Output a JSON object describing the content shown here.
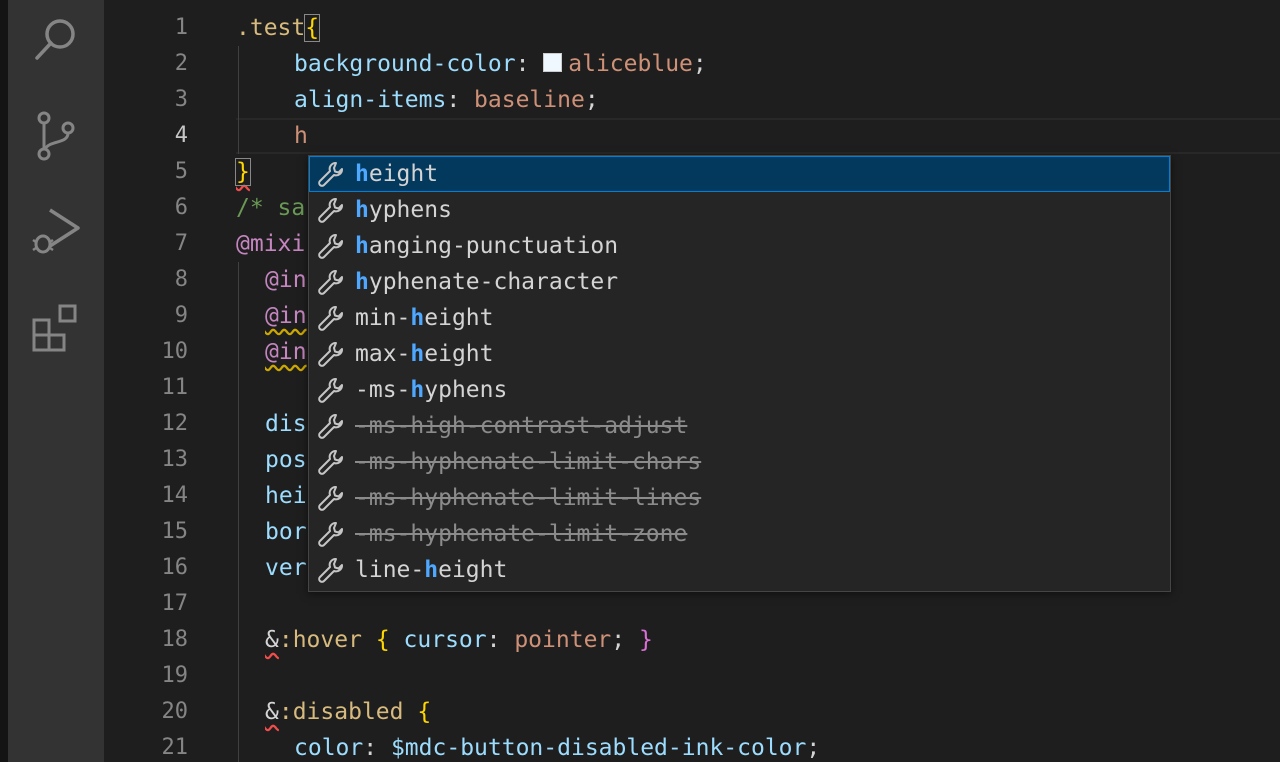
{
  "activity_bar": {
    "items": [
      {
        "icon": "search-icon"
      },
      {
        "icon": "source-control-icon"
      },
      {
        "icon": "run-debug-icon"
      },
      {
        "icon": "extensions-icon"
      }
    ]
  },
  "editor": {
    "line_numbers": [
      "1",
      "2",
      "3",
      "4",
      "5",
      "6",
      "7",
      "8",
      "9",
      "10",
      "11",
      "12",
      "13",
      "14",
      "15",
      "16",
      "17",
      "18",
      "19",
      "20",
      "21"
    ],
    "active_line": "4",
    "lines": {
      "l1_selector": ".test",
      "l1_brace": "{",
      "l2_prop": "background-color",
      "l2_value": "aliceblue",
      "l3_prop": "align-items",
      "l3_value": "baseline",
      "l4_text": "h",
      "l5_brace": "}",
      "l6_comment": "/* sa",
      "l7_mixin": "@mixi",
      "l8_include": "@in",
      "l9_include": "@in",
      "l10_include": "@in",
      "l12_prop": "dis",
      "l13_prop": "pos",
      "l14_prop": "hei",
      "l15_prop": "bor",
      "l16_prop": "ver",
      "l18_amp": "&",
      "l18_pseudo": ":hover",
      "l18_open": "{",
      "l18_prop": "cursor",
      "l18_value": "pointer",
      "l18_close": "}",
      "l20_amp": "&",
      "l20_pseudo": ":disabled",
      "l20_open": "{",
      "l21_prop": "color",
      "l21_value": "$mdc-button-disabled-ink-color"
    }
  },
  "suggestions": {
    "items": [
      {
        "pre": "",
        "match": "h",
        "post": "eight",
        "deprecated": false,
        "selected": true
      },
      {
        "pre": "",
        "match": "h",
        "post": "yphens",
        "deprecated": false,
        "selected": false
      },
      {
        "pre": "",
        "match": "h",
        "post": "anging-punctuation",
        "deprecated": false,
        "selected": false
      },
      {
        "pre": "",
        "match": "h",
        "post": "yphenate-character",
        "deprecated": false,
        "selected": false
      },
      {
        "pre": "min-",
        "match": "h",
        "post": "eight",
        "deprecated": false,
        "selected": false
      },
      {
        "pre": "max-",
        "match": "h",
        "post": "eight",
        "deprecated": false,
        "selected": false
      },
      {
        "pre": "-ms-",
        "match": "h",
        "post": "yphens",
        "deprecated": false,
        "selected": false
      },
      {
        "pre": "-ms-high-contrast-adjust",
        "match": "",
        "post": "",
        "deprecated": true,
        "selected": false
      },
      {
        "pre": "-ms-hyphenate-limit-chars",
        "match": "",
        "post": "",
        "deprecated": true,
        "selected": false
      },
      {
        "pre": "-ms-hyphenate-limit-lines",
        "match": "",
        "post": "",
        "deprecated": true,
        "selected": false
      },
      {
        "pre": "-ms-hyphenate-limit-zone",
        "match": "",
        "post": "",
        "deprecated": true,
        "selected": false
      },
      {
        "pre": "line-",
        "match": "h",
        "post": "eight",
        "deprecated": false,
        "selected": false
      }
    ]
  },
  "colors": {
    "accent_match": "#4fa8ff",
    "selected_bg": "#04395e"
  }
}
